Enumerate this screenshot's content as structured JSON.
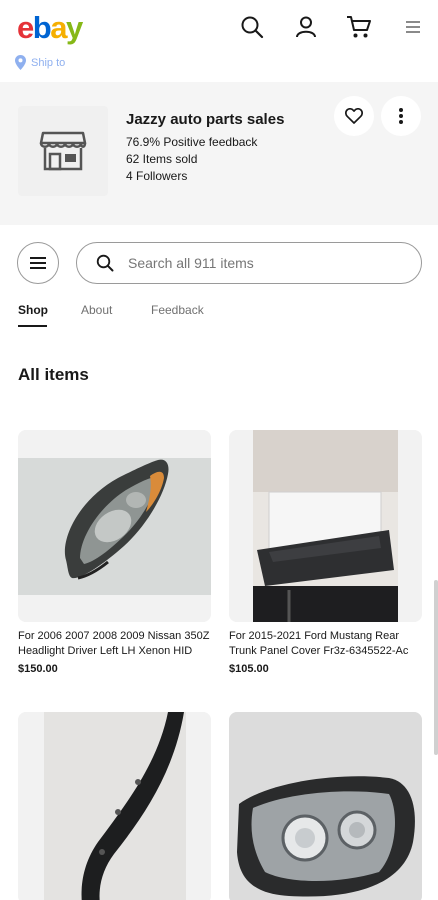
{
  "header": {
    "logo": {
      "e": "e",
      "b": "b",
      "a": "a",
      "y": "y"
    },
    "ship_to": "Ship to"
  },
  "store": {
    "name": "Jazzy auto parts sales",
    "feedback": "76.9% Positive feedback",
    "items_sold": "62 Items sold",
    "followers": "4 Followers"
  },
  "search": {
    "placeholder": "Search all 911 items"
  },
  "tabs": [
    {
      "label": "Shop",
      "active": true
    },
    {
      "label": "About",
      "active": false
    },
    {
      "label": "Feedback",
      "active": false
    }
  ],
  "section_title": "All items",
  "items": [
    {
      "title": "For 2006 2007 2008 2009 Nissan 350Z Headlight Driver Left LH Xenon HID",
      "price": "$150.00"
    },
    {
      "title": "For 2015-2021 Ford Mustang Rear Trunk Panel Cover Fr3z-6345522-Ac",
      "price": "$105.00"
    },
    {
      "title": "",
      "price": ""
    },
    {
      "title": "",
      "price": ""
    }
  ],
  "colors": {
    "ebay_red": "#e53238",
    "ebay_blue": "#0064d2",
    "ebay_yellow": "#f5af02",
    "ebay_green": "#86b817"
  }
}
